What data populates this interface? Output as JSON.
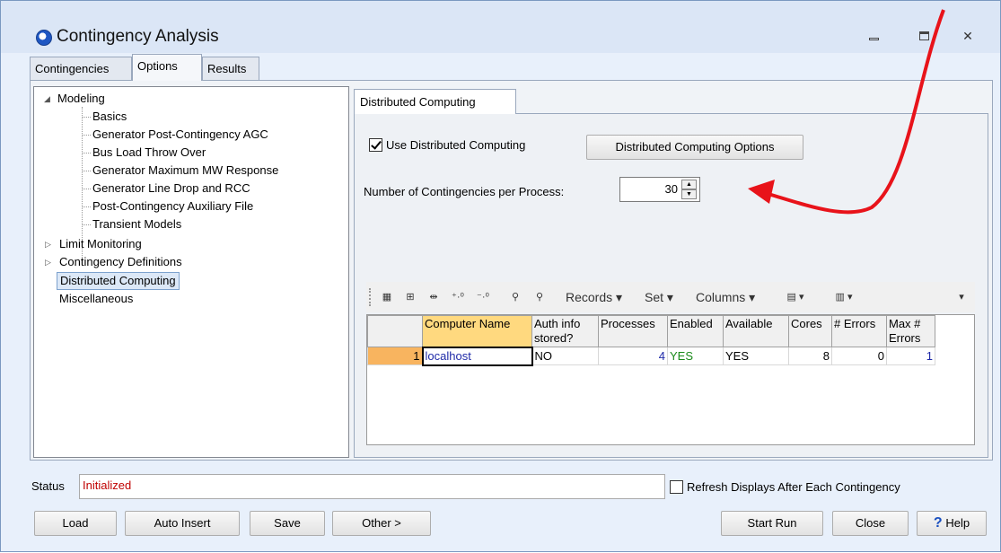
{
  "window": {
    "title": "Contingency Analysis",
    "controls": [
      "minimize",
      "maximize",
      "close"
    ]
  },
  "tabs": [
    {
      "label": "Contingencies",
      "active": false
    },
    {
      "label": "Options",
      "active": true
    },
    {
      "label": "Results",
      "active": false
    }
  ],
  "tree": {
    "modeling": "Modeling",
    "modeling_children": [
      "Basics",
      "Generator Post-Contingency AGC",
      "Bus Load Throw Over",
      "Generator Maximum MW Response",
      "Generator Line Drop and RCC",
      "Post-Contingency Auxiliary File",
      "Transient Models"
    ],
    "limit_monitoring": "Limit Monitoring",
    "contingency_definitions": "Contingency Definitions",
    "distributed_computing": "Distributed Computing",
    "miscellaneous": "Miscellaneous"
  },
  "panel": {
    "tab": "Distributed Computing",
    "use_distributed_label": "Use Distributed Computing",
    "use_distributed_checked": true,
    "options_button": "Distributed Computing Options",
    "num_per_process_label": "Number of Contingencies per Process:",
    "num_per_process_value": "30"
  },
  "toolbar": {
    "records": "Records ▾",
    "set": "Set ▾",
    "columns": "Columns ▾"
  },
  "grid": {
    "headers": [
      "Computer Name",
      "Auth info stored?",
      "Processes",
      "Enabled",
      "Available",
      "Cores",
      "# Errors",
      "Max # Errors"
    ],
    "rows": [
      {
        "num": "1",
        "computer_name": "localhost",
        "auth": "NO",
        "processes": "4",
        "enabled": "YES",
        "available": "YES",
        "cores": "8",
        "errors": "0",
        "max_errors": "1"
      }
    ]
  },
  "status": {
    "label": "Status",
    "value": "Initialized",
    "refresh_label": "Refresh Displays After Each Contingency",
    "refresh_checked": false
  },
  "buttons": {
    "load": "Load",
    "auto_insert": "Auto Insert",
    "save": "Save",
    "other": "Other >",
    "start_run": "Start Run",
    "close": "Close",
    "help": "Help"
  },
  "colors": {
    "annotation_arrow": "#e8131a",
    "status_text": "#c00000",
    "selected_header": "#ffd97f",
    "row_header": "#f8b45f"
  }
}
